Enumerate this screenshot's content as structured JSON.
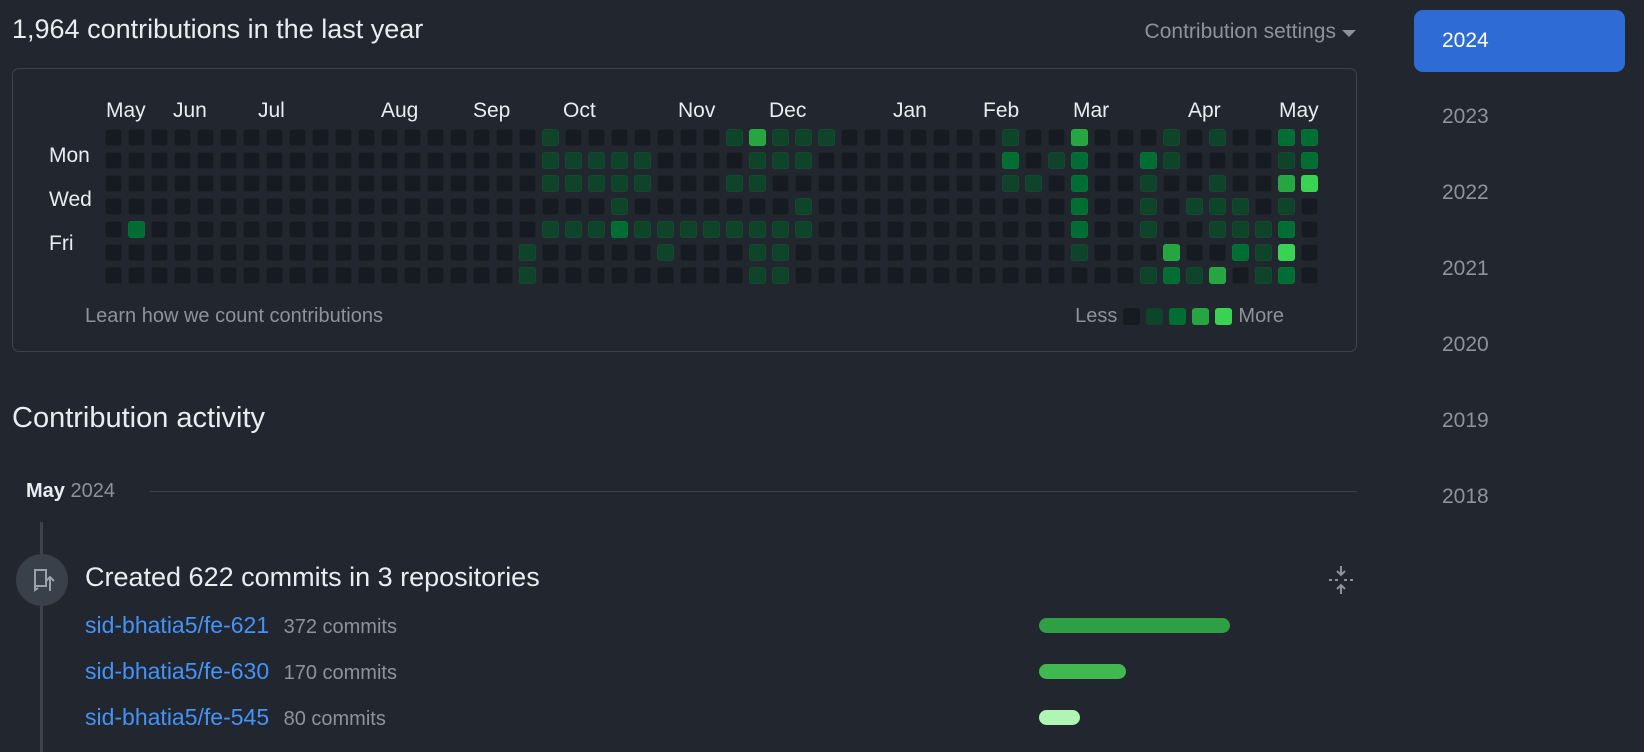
{
  "header": {
    "title": "1,964 contributions in the last year",
    "settings_label": "Contribution settings"
  },
  "calendar": {
    "months": [
      "May",
      "Jun",
      "Jul",
      "Aug",
      "Sep",
      "Oct",
      "Nov",
      "Dec",
      "Jan",
      "Feb",
      "Mar",
      "Apr",
      "May"
    ],
    "days": [
      "Mon",
      "Wed",
      "Fri"
    ],
    "learn_link": "Learn how we count contributions",
    "legend_less": "Less",
    "legend_more": "More",
    "level_colors": [
      "#161b22",
      "#0e4429",
      "#006d32",
      "#26a641",
      "#39d353"
    ],
    "weeks": 53,
    "active_cells": [
      [
        1,
        4,
        2
      ],
      [
        18,
        5,
        1
      ],
      [
        18,
        6,
        1
      ],
      [
        19,
        0,
        1
      ],
      [
        19,
        1,
        1
      ],
      [
        19,
        2,
        1
      ],
      [
        19,
        4,
        1
      ],
      [
        20,
        1,
        1
      ],
      [
        20,
        2,
        1
      ],
      [
        20,
        4,
        1
      ],
      [
        21,
        1,
        1
      ],
      [
        21,
        2,
        1
      ],
      [
        21,
        4,
        1
      ],
      [
        22,
        1,
        1
      ],
      [
        22,
        2,
        1
      ],
      [
        22,
        3,
        1
      ],
      [
        22,
        4,
        2
      ],
      [
        23,
        1,
        1
      ],
      [
        23,
        2,
        1
      ],
      [
        23,
        4,
        1
      ],
      [
        24,
        4,
        1
      ],
      [
        24,
        5,
        1
      ],
      [
        25,
        4,
        1
      ],
      [
        26,
        4,
        1
      ],
      [
        27,
        0,
        1
      ],
      [
        27,
        2,
        1
      ],
      [
        27,
        4,
        1
      ],
      [
        28,
        0,
        3
      ],
      [
        28,
        1,
        1
      ],
      [
        28,
        2,
        1
      ],
      [
        28,
        4,
        1
      ],
      [
        28,
        5,
        1
      ],
      [
        28,
        6,
        1
      ],
      [
        29,
        0,
        1
      ],
      [
        29,
        1,
        1
      ],
      [
        29,
        4,
        1
      ],
      [
        29,
        5,
        1
      ],
      [
        29,
        6,
        1
      ],
      [
        30,
        0,
        1
      ],
      [
        30,
        1,
        1
      ],
      [
        30,
        3,
        1
      ],
      [
        30,
        4,
        1
      ],
      [
        31,
        0,
        1
      ],
      [
        39,
        0,
        1
      ],
      [
        39,
        1,
        2
      ],
      [
        39,
        2,
        1
      ],
      [
        40,
        2,
        1
      ],
      [
        41,
        1,
        1
      ],
      [
        42,
        0,
        3
      ],
      [
        42,
        1,
        2
      ],
      [
        42,
        2,
        2
      ],
      [
        42,
        3,
        2
      ],
      [
        42,
        4,
        2
      ],
      [
        42,
        5,
        1
      ],
      [
        45,
        1,
        2
      ],
      [
        45,
        2,
        1
      ],
      [
        45,
        3,
        1
      ],
      [
        45,
        4,
        1
      ],
      [
        45,
        6,
        1
      ],
      [
        46,
        0,
        1
      ],
      [
        46,
        1,
        1
      ],
      [
        46,
        5,
        3
      ],
      [
        46,
        6,
        2
      ],
      [
        47,
        3,
        1
      ],
      [
        47,
        6,
        1
      ],
      [
        48,
        0,
        1
      ],
      [
        48,
        2,
        1
      ],
      [
        48,
        3,
        1
      ],
      [
        48,
        4,
        1
      ],
      [
        48,
        6,
        3
      ],
      [
        49,
        3,
        1
      ],
      [
        49,
        4,
        1
      ],
      [
        49,
        5,
        2
      ],
      [
        50,
        4,
        1
      ],
      [
        50,
        5,
        1
      ],
      [
        50,
        6,
        1
      ],
      [
        51,
        0,
        2
      ],
      [
        51,
        1,
        1
      ],
      [
        51,
        2,
        3
      ],
      [
        51,
        3,
        1
      ],
      [
        51,
        4,
        2
      ],
      [
        51,
        5,
        4
      ],
      [
        51,
        6,
        2
      ],
      [
        52,
        0,
        2
      ],
      [
        52,
        1,
        2
      ],
      [
        52,
        2,
        4
      ]
    ]
  },
  "activity": {
    "title": "Contribution activity",
    "month": "May",
    "year": "2024",
    "summary": "Created 622 commits in 3 repositories",
    "repos": [
      {
        "name": "sid-bhatia5/fe-621",
        "count": "372 commits",
        "commits": 372,
        "color": "#2ea043"
      },
      {
        "name": "sid-bhatia5/fe-630",
        "count": "170 commits",
        "commits": 170,
        "color": "#3fb950"
      },
      {
        "name": "sid-bhatia5/fe-545",
        "count": "80 commits",
        "commits": 80,
        "color": "#aff5b4"
      }
    ]
  },
  "years": [
    "2024",
    "2023",
    "2022",
    "2021",
    "2020",
    "2019",
    "2018"
  ],
  "selected_year": "2024"
}
